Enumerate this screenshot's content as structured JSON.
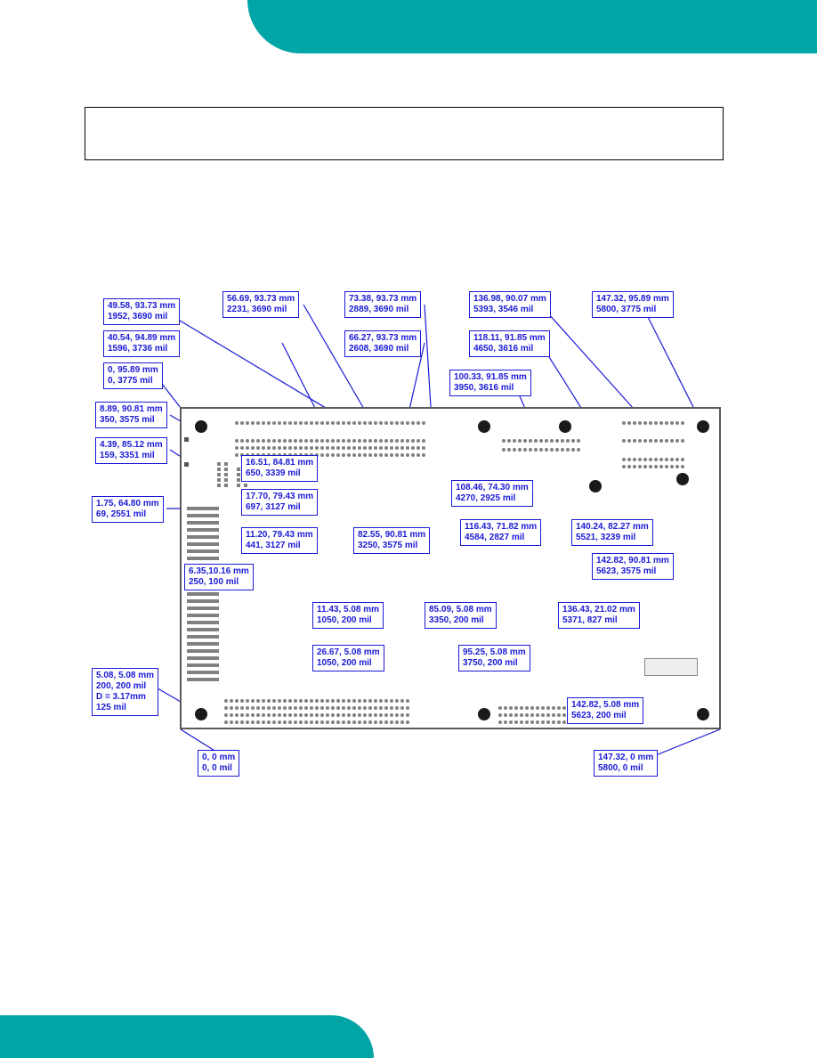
{
  "labels": [
    {
      "mm": "49.58,  93.73 mm",
      "mil": "1952, 3690 mil"
    },
    {
      "mm": "56.69, 93.73 mm",
      "mil": "2231, 3690 mil"
    },
    {
      "mm": "73.38, 93.73 mm",
      "mil": "2889, 3690 mil"
    },
    {
      "mm": "136.98, 90.07 mm",
      "mil": "5393, 3546 mil"
    },
    {
      "mm": "147.32, 95.89 mm",
      "mil": "5800, 3775 mil"
    },
    {
      "mm": "40.54, 94.89 mm",
      "mil": "1596, 3736 mil"
    },
    {
      "mm": "66.27, 93.73 mm",
      "mil": "2608, 3690 mil"
    },
    {
      "mm": "118.11,  91.85 mm",
      "mil": "4650, 3616 mil"
    },
    {
      "mm": "0, 95.89 mm",
      "mil": "0, 3775 mil"
    },
    {
      "mm": "100.33,  91.85 mm",
      "mil": "3950, 3616 mil"
    },
    {
      "mm": "8.89,  90.81 mm",
      "mil": "350, 3575 mil"
    },
    {
      "mm": "4.39,  85.12 mm",
      "mil": "159, 3351 mil"
    },
    {
      "mm": "16.51, 84.81 mm",
      "mil": "650, 3339 mil"
    },
    {
      "mm": "1.75, 64.80 mm",
      "mil": "69, 2551 mil"
    },
    {
      "mm": "17.70,  79.43 mm",
      "mil": "697, 3127 mil"
    },
    {
      "mm": "108.46, 74.30 mm",
      "mil": "4270, 2925 mil"
    },
    {
      "mm": "11.20,  79.43 mm",
      "mil": "441, 3127 mil"
    },
    {
      "mm": "82.55, 90.81 mm",
      "mil": "3250, 3575 mil"
    },
    {
      "mm": "116.43, 71.82 mm",
      "mil": "4584, 2827 mil"
    },
    {
      "mm": "140.24, 82.27 mm",
      "mil": "5521,  3239 mil"
    },
    {
      "mm": "6.35,10.16 mm",
      "mil": "250, 100 mil"
    },
    {
      "mm": "142.82, 90.81 mm",
      "mil": "5623, 3575 mil"
    },
    {
      "mm": "11.43, 5.08 mm",
      "mil": "1050, 200 mil"
    },
    {
      "mm": "85.09, 5.08 mm",
      "mil": "3350, 200 mil"
    },
    {
      "mm": "136.43, 21.02 mm",
      "mil": "5371, 827 mil"
    },
    {
      "mm": "26.67, 5.08 mm",
      "mil": "1050, 200 mil"
    },
    {
      "mm": "95.25, 5.08 mm",
      "mil": "3750, 200 mil"
    },
    {
      "mm": "5.08, 5.08 mm",
      "mil": "200, 200 mil",
      "extra": "D = 3.17mm",
      "extra2": "   125 mil"
    },
    {
      "mm": "142.82,  5.08 mm",
      "mil": "5623, 200 mil"
    },
    {
      "mm": "0, 0 mm",
      "mil": "0, 0 mil"
    },
    {
      "mm": "147.32, 0 mm",
      "mil": "5800, 0 mil"
    }
  ]
}
